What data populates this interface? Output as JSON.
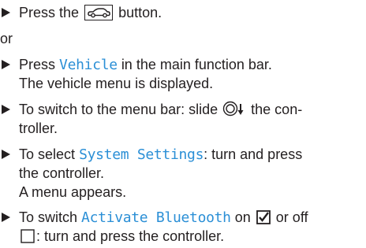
{
  "steps": [
    {
      "before": "Press the",
      "icon": "car-icon",
      "after": "button."
    },
    {
      "connector": "or"
    },
    {
      "before": "Press",
      "ui": "Vehicle",
      "after": "in the main function bar.",
      "result": "The vehicle menu is displayed."
    },
    {
      "line1": "To switch to the menu bar: slide",
      "icon": "controller-slide-down-icon",
      "line1_after": "the con-",
      "line2": "troller."
    },
    {
      "before": "To select",
      "ui": "System Settings",
      "after": ": turn and press",
      "line2": "the controller.",
      "result": "A menu appears."
    },
    {
      "before": "To switch",
      "ui": "Activate Bluetooth",
      "after": "on",
      "on_icon": "checked-box-icon",
      "after2": "or off",
      "off_icon": "unchecked-box-icon",
      "line2": ": turn and press the controller."
    }
  ],
  "colors": {
    "text": "#231f20",
    "ui_term": "#2b8fd6"
  }
}
